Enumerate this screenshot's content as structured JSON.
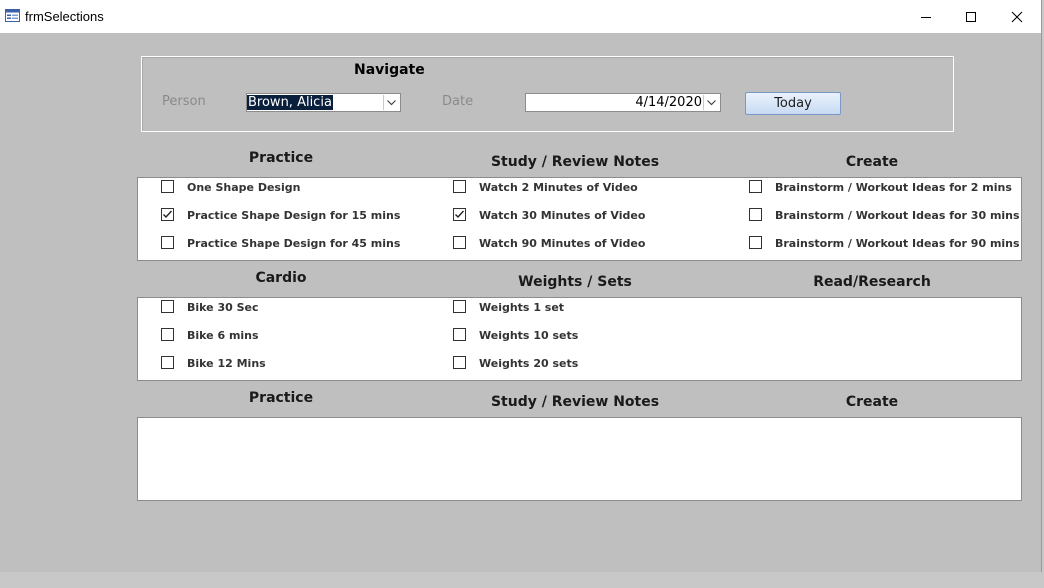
{
  "window": {
    "title": "frmSelections",
    "icon": "form-icon",
    "controls": [
      "minimize-icon",
      "maximize-icon",
      "close-icon"
    ]
  },
  "navigate": {
    "title": "Navigate",
    "person_label": "Person",
    "person_value": "Brown, Alicia",
    "date_label": "Date",
    "date_value": "4/14/2020",
    "today_label": "Today"
  },
  "section1": {
    "headers": [
      "Practice",
      "Study / Review Notes",
      "Create"
    ],
    "columns": [
      [
        {
          "label": "One Shape Design",
          "checked": false
        },
        {
          "label": "Practice Shape Design for 15 mins",
          "checked": true
        },
        {
          "label": "Practice Shape Design for 45 mins",
          "checked": false
        }
      ],
      [
        {
          "label": "Watch 2 Minutes of Video",
          "checked": false
        },
        {
          "label": "Watch 30 Minutes of Video",
          "checked": true
        },
        {
          "label": "Watch 90 Minutes of Video",
          "checked": false
        }
      ],
      [
        {
          "label": "Brainstorm / Workout Ideas for 2 mins",
          "checked": false
        },
        {
          "label": "Brainstorm / Workout Ideas for 30 mins",
          "checked": false
        },
        {
          "label": "Brainstorm / Workout Ideas for 90 mins",
          "checked": false
        }
      ]
    ]
  },
  "section2": {
    "headers": [
      "Cardio",
      "Weights / Sets",
      "Read/Research"
    ],
    "columns": [
      [
        {
          "label": "Bike 30 Sec",
          "checked": false
        },
        {
          "label": "Bike 6 mins",
          "checked": false
        },
        {
          "label": "Bike 12 Mins",
          "checked": false
        }
      ],
      [
        {
          "label": "Weights 1 set",
          "checked": false
        },
        {
          "label": "Weights 10 sets",
          "checked": false
        },
        {
          "label": "Weights 20 sets",
          "checked": false
        }
      ],
      []
    ]
  },
  "section3": {
    "headers": [
      "Practice",
      "Study / Review Notes",
      "Create"
    ]
  }
}
